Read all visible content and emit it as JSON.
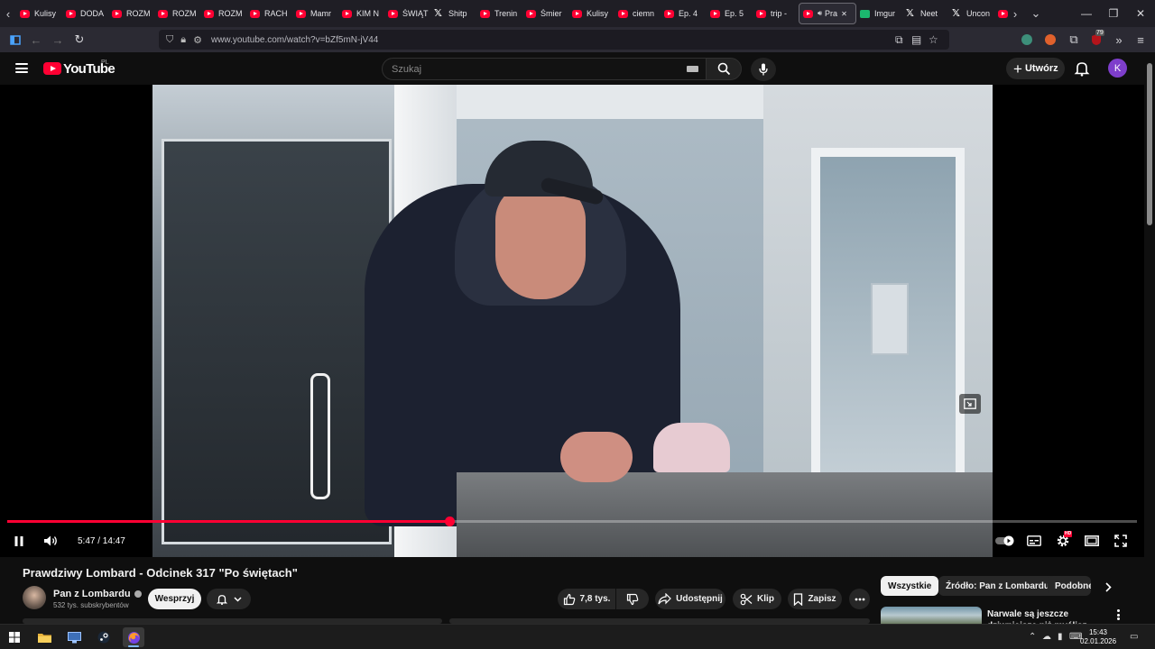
{
  "browser": {
    "tabs": [
      {
        "title": "Kulisy",
        "favicon": "youtube"
      },
      {
        "title": "DODA",
        "favicon": "youtube"
      },
      {
        "title": "ROZM",
        "favicon": "youtube"
      },
      {
        "title": "ROZM",
        "favicon": "youtube"
      },
      {
        "title": "ROZM",
        "favicon": "youtube"
      },
      {
        "title": "RACH",
        "favicon": "youtube"
      },
      {
        "title": "Mamr",
        "favicon": "youtube"
      },
      {
        "title": "KIM N",
        "favicon": "youtube"
      },
      {
        "title": "ŚWIĄT",
        "favicon": "youtube"
      },
      {
        "title": "Shitp",
        "favicon": "x"
      },
      {
        "title": "Trenin",
        "favicon": "youtube"
      },
      {
        "title": "Śmier",
        "favicon": "youtube"
      },
      {
        "title": "Kulisy",
        "favicon": "youtube"
      },
      {
        "title": "ciemn",
        "favicon": "youtube"
      },
      {
        "title": "Ep. 4",
        "favicon": "youtube"
      },
      {
        "title": "Ep. 5",
        "favicon": "youtube"
      },
      {
        "title": "trip -",
        "favicon": "youtube"
      },
      {
        "title": "Pra",
        "favicon": "youtube",
        "active": true
      },
      {
        "title": "Imgur",
        "favicon": "imgur"
      },
      {
        "title": "Neet",
        "favicon": "x"
      },
      {
        "title": "Uncon",
        "favicon": "x"
      },
      {
        "title": "",
        "favicon": "youtube"
      }
    ],
    "url": "www.youtube.com/watch?v=bZf5mN-jV44",
    "extension_badge": "79"
  },
  "youtube": {
    "logo_text": "YouTube",
    "country_code": "PL",
    "search_placeholder": "Szukaj",
    "create_label": "Utwórz",
    "avatar_letter": "K"
  },
  "player": {
    "current_time": "5:47",
    "duration": "14:47",
    "progress_fraction": 0.391,
    "time_display": "5:47 / 14:47",
    "settings_badge": "HD"
  },
  "video": {
    "title": "Prawdziwy Lombard - Odcinek 317 \"Po świętach\"",
    "channel_name": "Pan z Lombardu",
    "subscribers": "532 tys. subskrybentów",
    "support_label": "Wesprzyj",
    "likes": "7,8 tys.",
    "share_label": "Udostępnij",
    "clip_label": "Klip",
    "save_label": "Zapisz"
  },
  "sidebar": {
    "chips": [
      "Wszystkie",
      "Źródło: Pan z Lombardu",
      "Podobne"
    ],
    "recommendation_title": "Narwale są jeszcze dziwniejsze niż myślisz"
  },
  "taskbar": {
    "time": "15:43",
    "date": "02.01.2026"
  },
  "colors": {
    "accent": "#ff0033",
    "background": "#0f0f0f",
    "avatar": "#7e3ecb"
  }
}
